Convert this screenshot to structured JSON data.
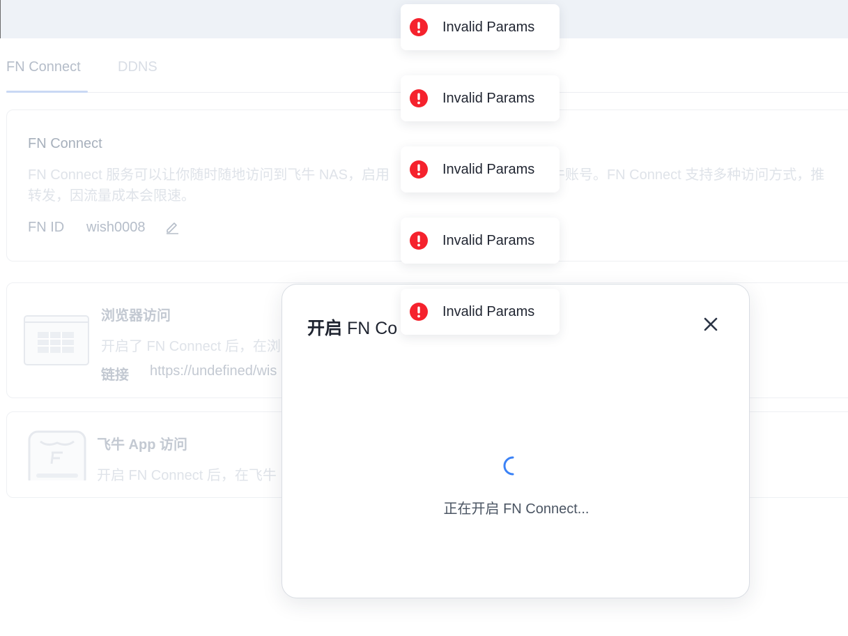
{
  "tabs": [
    {
      "label": "FN Connect",
      "active": true
    },
    {
      "label": "DDNS",
      "active": false
    }
  ],
  "info_card": {
    "title": "FN Connect",
    "description_line1": "FN Connect 服务可以让你随时随地访问到飞牛 NAS，启用",
    "description_line1_tail": "飞牛账号。FN Connect 支持多种访问方式，推",
    "description_line2": "转发，因流量成本会限速。",
    "id_label": "FN ID",
    "id_value": "wish0008"
  },
  "browser_card": {
    "title": "浏览器访问",
    "description": "开启了 FN Connect 后，在浏",
    "link_label": "链接",
    "link_value": "https://undefined/wis"
  },
  "app_card": {
    "title": "飞牛 App 访问",
    "description": "开启 FN Connect 后，在飞牛"
  },
  "modal": {
    "title_bold": "开启",
    "title_rest": " FN Co",
    "status": "正在开启 FN Connect..."
  },
  "toasts": [
    {
      "message": "Invalid Params"
    },
    {
      "message": "Invalid Params"
    },
    {
      "message": "Invalid Params"
    },
    {
      "message": "Invalid Params"
    },
    {
      "message": "Invalid Params"
    }
  ],
  "colors": {
    "error": "#f5222d",
    "accent": "#3b82f6"
  }
}
